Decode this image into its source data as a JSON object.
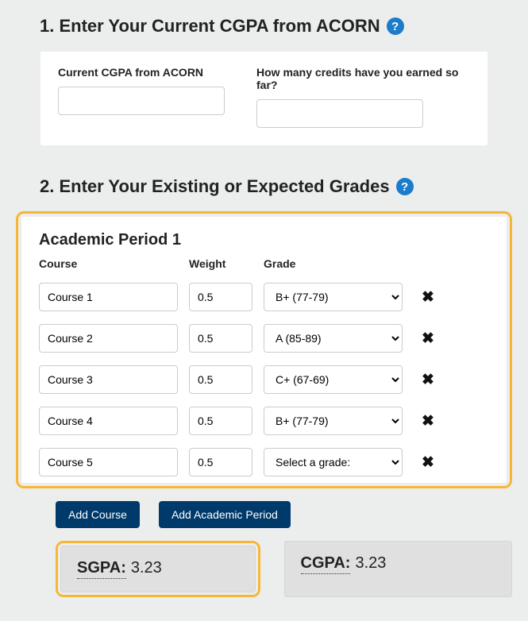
{
  "section1": {
    "title": "1. Enter Your Current CGPA from ACORN",
    "cgpa_label": "Current CGPA from ACORN",
    "cgpa_value": "",
    "credits_label": "How many credits have you earned so far?",
    "credits_value": ""
  },
  "section2": {
    "title": "2. Enter Your Existing or Expected Grades",
    "period_title": "Academic Period 1",
    "headers": {
      "course": "Course",
      "weight": "Weight",
      "grade": "Grade"
    },
    "rows": [
      {
        "course": "Course 1",
        "weight": "0.5",
        "grade": "B+ (77-79)"
      },
      {
        "course": "Course 2",
        "weight": "0.5",
        "grade": "A (85-89)"
      },
      {
        "course": "Course 3",
        "weight": "0.5",
        "grade": "C+ (67-69)"
      },
      {
        "course": "Course 4",
        "weight": "0.5",
        "grade": "B+ (77-79)"
      },
      {
        "course": "Course 5",
        "weight": "0.5",
        "grade": "Select a grade:"
      }
    ],
    "add_course_label": "Add Course",
    "add_period_label": "Add Academic Period",
    "sgpa_label": "SGPA:",
    "sgpa_value": "3.23",
    "cgpa_label": "CGPA:",
    "cgpa_value": "3.23"
  }
}
